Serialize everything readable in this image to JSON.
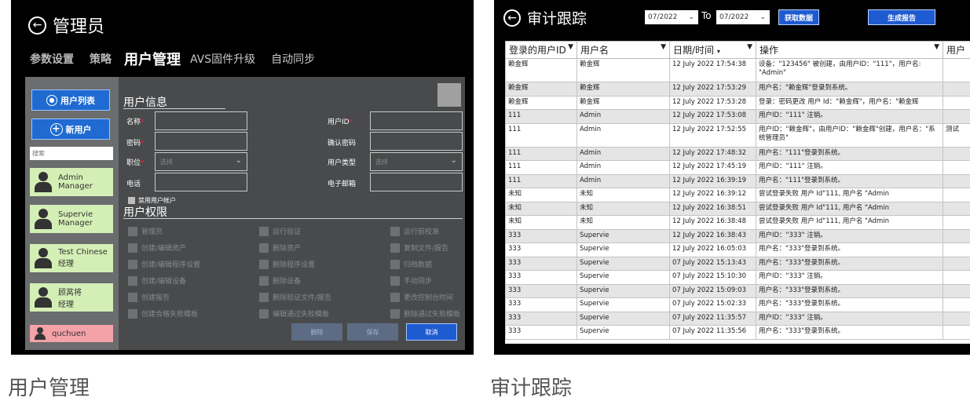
{
  "left": {
    "title": "管理员",
    "tabs": [
      "参数设置",
      "策略",
      "用户管理",
      "AVS固件升级",
      "自动同步"
    ],
    "active_tab": 2,
    "sidebar": {
      "user_list_button": "用户列表",
      "new_user_button": "新用户",
      "search_placeholder": "搜索",
      "users": [
        {
          "name": "Admin",
          "role": "Manager"
        },
        {
          "name": "Supervie",
          "role": "Manager"
        },
        {
          "name": "Test Chinese",
          "role": "经理"
        },
        {
          "name": "顾莴将",
          "role": "经理"
        },
        {
          "name": "quchuen",
          "role": ""
        }
      ]
    },
    "form": {
      "user_info_title": "用户信息",
      "name_label": "名称",
      "userid_label": "用户ID",
      "password_label": "密码",
      "confirm_password_label": "确认密码",
      "position_label": "职位",
      "position_placeholder": "选择",
      "user_type_label": "用户类型",
      "user_type_placeholder": "选择",
      "phone_label": "电话",
      "email_label": "电子邮箱",
      "disable_account_label": "禁用用户帐户",
      "permissions_title": "用户权限",
      "permissions": [
        [
          "管理员",
          "运行验证",
          "运行前校准"
        ],
        [
          "创建/编辑资产",
          "删除资产",
          "复制文件/报告"
        ],
        [
          "创建/编辑程序设置",
          "删除程序设置",
          "归档数据"
        ],
        [
          "创建/编辑设备",
          "删除设备",
          "手动同步"
        ],
        [
          "创建报告",
          "删除验证文件/报告",
          "更改控制台时间"
        ],
        [
          "创建合格失败模板",
          "编辑通过失败模板",
          "删除通过失败模板"
        ]
      ],
      "delete_button": "删除",
      "save_button": "保存",
      "cancel_button": "取消"
    }
  },
  "right": {
    "title": "审计跟踪",
    "date_from": "07/2022",
    "to_label": "To",
    "date_to": "07/2022",
    "fetch_button": "获取数据",
    "report_button": "生成报告",
    "columns": [
      "登录的用户ID",
      "用户名",
      "日期/时间",
      "操作",
      "用户"
    ],
    "rows": [
      [
        "赖金辉",
        "赖金辉",
        "12 July 2022 17:54:38",
        "设备：\"123456\" 被创建，由用户ID：\"111\"，用户名: \"Admin\"",
        ""
      ],
      [
        "赖金辉",
        "赖金辉",
        "12 July 2022 17:53:29",
        "用户名：\"赖金辉\"登录到系统。",
        ""
      ],
      [
        "赖金辉",
        "赖金辉",
        "12 July 2022 17:53:28",
        "登录：密码更改 用户 Id：\"赖金辉\"，用户名：\"赖金辉",
        ""
      ],
      [
        "111",
        "Admin",
        "12 July 2022 17:53:08",
        "用户ID：\"111\" 注销。",
        ""
      ],
      [
        "111",
        "Admin",
        "12 July 2022 17:52:55",
        "用户ID：\"赖金辉\"，由用户ID：\"赖金辉\"创建，用户名：\"系统管理员\"",
        "测试"
      ],
      [
        "111",
        "Admin",
        "12 July 2022 17:48:32",
        "用户名：\"111\"登录到系统。",
        ""
      ],
      [
        "111",
        "Admin",
        "12 July 2022 17:45:19",
        "用户ID：\"111\" 注销。",
        ""
      ],
      [
        "111",
        "Admin",
        "12 July 2022 16:39:19",
        "用户名：\"111\"登录到系统。",
        ""
      ],
      [
        "未知",
        "未知",
        "12 July 2022 16:39:12",
        "尝试登录失败 用户 Id\"111, 用户名 \"Admin",
        ""
      ],
      [
        "未知",
        "未知",
        "12 July 2022 16:38:51",
        "尝试登录失败 用户 Id\"111, 用户名 \"Admin",
        ""
      ],
      [
        "未知",
        "未知",
        "12 July 2022 16:38:48",
        "尝试登录失败 用户 Id\"111, 用户名 \"Admin",
        ""
      ],
      [
        "333",
        "Supervie",
        "12 July 2022 16:38:43",
        "用户ID：\"333\" 注销。",
        ""
      ],
      [
        "333",
        "Supervie",
        "12 July 2022 16:05:03",
        "用户名：\"333\"登录到系统。",
        ""
      ],
      [
        "333",
        "Supervie",
        "07 July 2022 15:13:43",
        "用户名：\"333\"登录到系统。",
        ""
      ],
      [
        "333",
        "Supervie",
        "07 July 2022 15:10:30",
        "用户ID：\"333\" 注销。",
        ""
      ],
      [
        "333",
        "Supervie",
        "07 July 2022 15:09:03",
        "用户名：\"333\"登录到系统。",
        ""
      ],
      [
        "333",
        "Supervie",
        "07 July 2022 15:02:33",
        "用户名：\"333\"登录到系统。",
        ""
      ],
      [
        "333",
        "Supervie",
        "07 July 2022 11:35:57",
        "用户ID：\"333\" 注销。",
        ""
      ],
      [
        "333",
        "Supervie",
        "07 July 2022 11:35:56",
        "用户名：\"333\"登录到系统。",
        ""
      ]
    ]
  },
  "captions": {
    "left": "用户管理",
    "right": "审计跟踪"
  }
}
